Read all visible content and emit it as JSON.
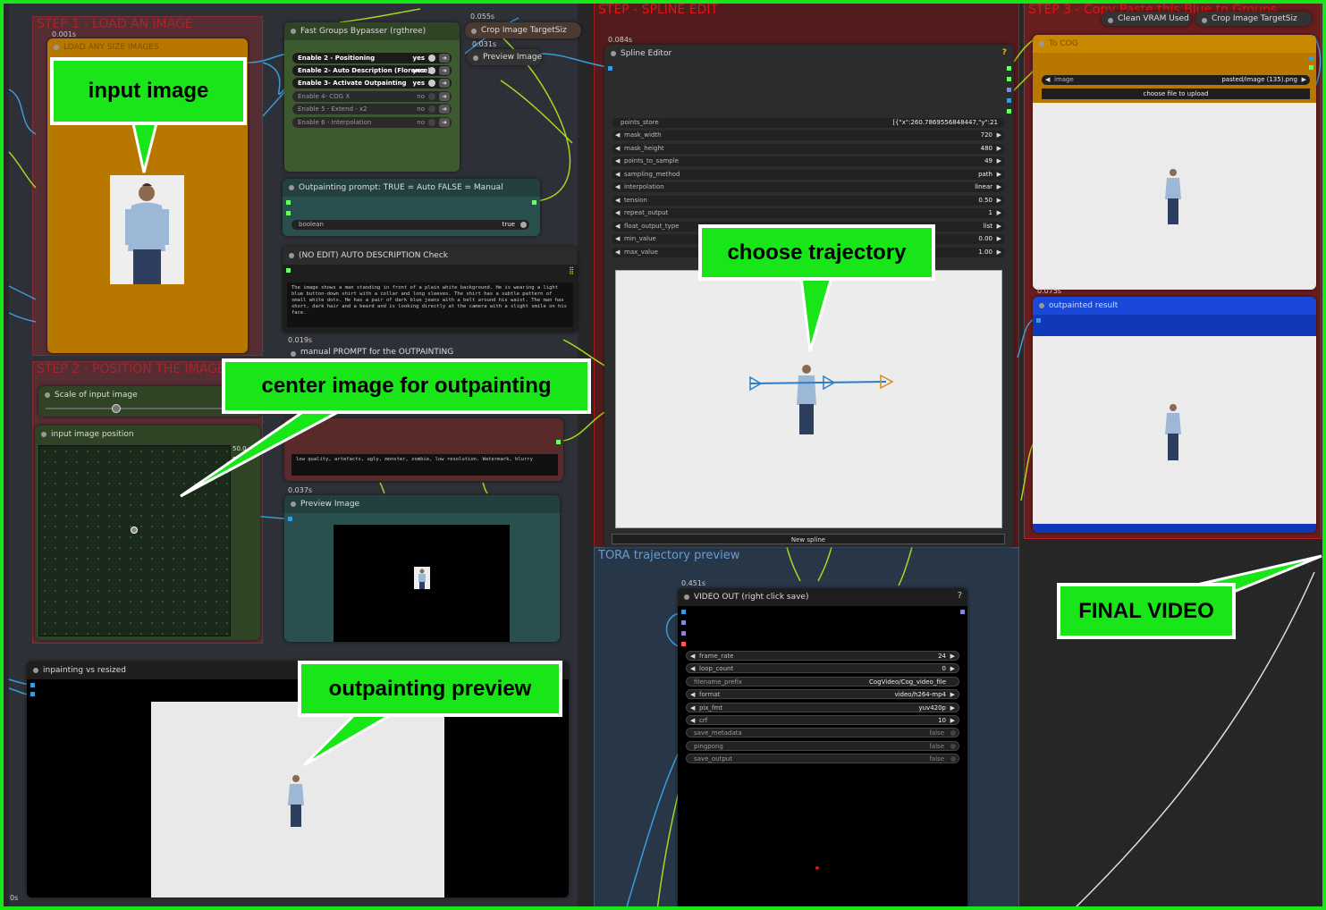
{
  "callouts": {
    "input_image": "input image",
    "center_image": "center image for outpainting",
    "choose_trajectory": "choose trajectory",
    "outpainting_preview": "outpainting preview",
    "final_video": "FINAL VIDEO"
  },
  "groups": {
    "step1": "STEP 1 - LOAD AN IMAGE",
    "step2": "STEP 2 - POSITION THE IMAGE",
    "step_spline": "STEP - SPLINE EDIT",
    "step3": "STEP 3 - Copy Paste this Blue to Groups",
    "tora_preview": "TORA trajectory preview"
  },
  "timings": {
    "t1": "0.001s",
    "t2": "0.055s",
    "t3": "0.031s",
    "t4": "0.084s",
    "t5": "0.019s",
    "t6": "0.037s",
    "t7": "0.075s",
    "t8": "0.451s",
    "t9": "0s"
  },
  "nodes": {
    "load_image": {
      "title": "LOAD ANY SIZE IMAGES"
    },
    "bypasser": {
      "title": "Fast Groups Bypasser (rgthree)",
      "rows": [
        {
          "label": "Enable 2 - Positioning",
          "value": "yes"
        },
        {
          "label": "Enable 2- Auto Description (Florence)",
          "value": "yes"
        },
        {
          "label": "Enable 3- Activate Outpainting",
          "value": "yes"
        },
        {
          "label": "Enable 4- COG X",
          "value": "no"
        },
        {
          "label": "Enable 5 - Extend - x2",
          "value": "no"
        },
        {
          "label": "Enable 6 - Interpolation",
          "value": "no"
        }
      ]
    },
    "crop_image": {
      "title": "Crop Image TargetSiz"
    },
    "preview_image_top": {
      "title": "Preview Image"
    },
    "outpaint_prompt": {
      "title": "Outpainting prompt:      TRUE = Auto     FALSE = Manual",
      "widget_label": "boolean",
      "widget_value": "true"
    },
    "auto_desc": {
      "title": "(NO EDIT) AUTO DESCRIPTION Check",
      "text": "The image shows a man standing in front of a plain white background. He is wearing a light blue button-down shirt with a collar and long sleeves. The shirt has a subtle pattern of small white dots. He has a pair of dark blue jeans with a belt around his waist. The man has short, dark hair and a beard and is looking directly at the camera with a slight smile on his face."
    },
    "manual_prompt": {
      "title": "manual PROMPT for the OUTPAINTING"
    },
    "negative_prompt": {
      "text": "low quality, artefacts, ugly, monster, zombie, low resolution. Watermark, blurry"
    },
    "preview_image_mid": {
      "title": "Preview Image"
    },
    "scale_input": {
      "title": "Scale of input image"
    },
    "input_position": {
      "title": "input image position",
      "value_x": "50.0",
      "value_y": "50"
    },
    "inpainting_vs_resized": {
      "title": "inpainting vs resized"
    },
    "spline_editor": {
      "title": "Spline Editor",
      "points_store_label": "points_store",
      "points_store_value": "[{\"x\":260.7869556848447,\"y\":21",
      "widgets": [
        {
          "label": "mask_width",
          "value": "720"
        },
        {
          "label": "mask_height",
          "value": "480"
        },
        {
          "label": "points_to_sample",
          "value": "49"
        },
        {
          "label": "sampling_method",
          "value": "path"
        },
        {
          "label": "interpolation",
          "value": "linear"
        },
        {
          "label": "tension",
          "value": "0.50"
        },
        {
          "label": "repeat_output",
          "value": "1"
        },
        {
          "label": "float_output_type",
          "value": "list"
        },
        {
          "label": "min_value",
          "value": "0.00"
        },
        {
          "label": "max_value",
          "value": "1.00"
        }
      ],
      "new_spline": "New spline",
      "help": "?"
    },
    "clean_vram": {
      "title": "Clean VRAM Used"
    },
    "crop_image_right": {
      "title": "Crop Image TargetSiz"
    },
    "to_cog": {
      "title": "To COG",
      "image_label": "image",
      "image_value": "pasted/image (135).png",
      "upload": "choose file to upload"
    },
    "outpainted_result": {
      "title": "outpainted result"
    },
    "video_out": {
      "title": "VIDEO OUT (right click save)",
      "help": "?",
      "widgets": [
        {
          "label": "frame_rate",
          "value": "24",
          "arrows": true
        },
        {
          "label": "loop_count",
          "value": "0",
          "arrows": true
        },
        {
          "label": "filename_prefix",
          "value": "CogVideo/Cog_video_file",
          "arrows": false
        },
        {
          "label": "format",
          "value": "video/h264-mp4",
          "arrows": true
        },
        {
          "label": "pix_fmt",
          "value": "yuv420p",
          "arrows": true
        },
        {
          "label": "crf",
          "value": "10",
          "arrows": true
        },
        {
          "label": "save_metadata",
          "value": "false",
          "arrows": false
        },
        {
          "label": "pingpong",
          "value": "false",
          "arrows": false
        },
        {
          "label": "save_output",
          "value": "false",
          "arrows": false
        }
      ]
    }
  },
  "colors": {
    "callout_green": "#19e619",
    "group_red": "#8b1a1a",
    "load_image_orange": "#b87800",
    "blue_node": "#1038b8",
    "teal_node": "#2a4f4f",
    "wire_green": "#a6d81f",
    "wire_blue": "#3b9bd8"
  }
}
